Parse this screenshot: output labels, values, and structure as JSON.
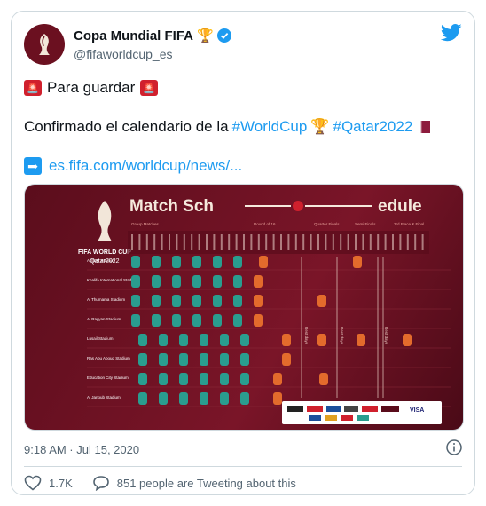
{
  "author": {
    "name": "Copa Mundial FIFA",
    "handle": "@fifaworldcup_es"
  },
  "tweet": {
    "line1_text": "Para guardar",
    "line2_prefix": "Confirmado el calendario de la",
    "hashtag1": "#WorldCup",
    "hashtag2": "#Qatar2022",
    "link_text": "es.fifa.com/worldcup/news/..."
  },
  "media": {
    "title_left": "Match Sch",
    "title_right": "edule",
    "logo_text": "FIFA WORLD CUP",
    "logo_sub": "Qatar2022",
    "stadiums": [
      "Al Bayt Stadium",
      "Khalifa International Stadium",
      "Al Thumama Stadium",
      "Al Rayyan Stadium",
      "Lusail Stadium",
      "Ras Abu Aboud Stadium",
      "Education City Stadium",
      "Al Janoub Stadium"
    ],
    "sections": [
      "Group Matches",
      "Round of 16",
      "Quarter Finals",
      "Semi Finals",
      "3rd Place & Final"
    ],
    "rest_day_label": "Rest days",
    "sponsor_visa": "VISA"
  },
  "meta": {
    "timestamp": "9:18 AM · Jul 15, 2020"
  },
  "actions": {
    "likes": "1.7K",
    "tweeting": "851 people are Tweeting about this"
  },
  "colors": {
    "accent": "#1d9bf0",
    "brand": "#6b1020",
    "teal": "#2a9d8f",
    "orange": "#e36b2c"
  }
}
